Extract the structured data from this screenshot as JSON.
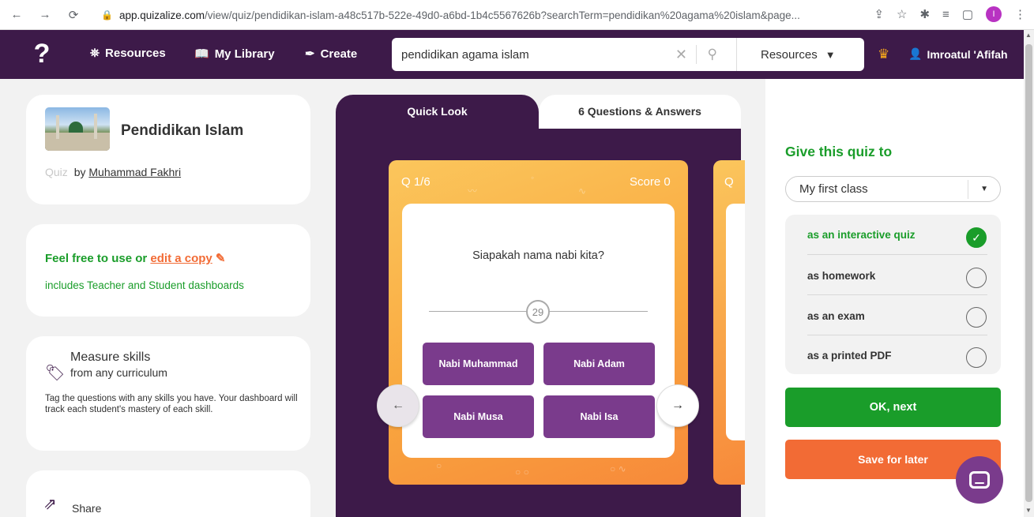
{
  "browser": {
    "nav": [
      "←",
      "→",
      "⟳"
    ],
    "url_host": "app.quizalize.com",
    "url_path": "/view/quiz/pendidikan-islam-a48c517b-522e-49d0-a6bd-1b4c5567626b?searchTerm=pendidikan%20agama%20islam&page...",
    "profile_initial": "I"
  },
  "header": {
    "logo": "?",
    "menu": [
      {
        "label": "Resources",
        "icon": "binoculars-icon"
      },
      {
        "label": "My Library",
        "icon": "book-icon"
      },
      {
        "label": "Create",
        "icon": "pen-icon"
      }
    ],
    "search_value": "pendidikan agama islam",
    "resources_dropdown": "Resources",
    "user_name": "Imroatul 'Afifah"
  },
  "quiz": {
    "title": "Pendidikan Islam",
    "type_label": "Quiz",
    "by": "by",
    "author": "Muhammad Fakhri"
  },
  "free": {
    "prefix": "Feel free to use or",
    "edit_link": "edit a copy",
    "sub": "includes Teacher and Student dashboards"
  },
  "skills": {
    "title": "Measure skills",
    "subtitle": "from any curriculum",
    "description": "Tag the questions with any skills you have. Your dashboard will track each student's mastery of each skill."
  },
  "share": {
    "label": "Share"
  },
  "tabs": {
    "quick_look": "Quick Look",
    "questions": "6 Questions & Answers"
  },
  "question_card": {
    "number": "Q 1/6",
    "score": "Score 0",
    "question": "Siapakah nama nabi kita?",
    "timer": "29",
    "answers": [
      "Nabi Muhammad",
      "Nabi Adam",
      "Nabi Musa",
      "Nabi Isa"
    ],
    "next_card_label": "Q"
  },
  "give": {
    "title": "Give this quiz to",
    "class_select": "My first class",
    "options": [
      {
        "label": "as an interactive quiz",
        "checked": true
      },
      {
        "label": "as homework",
        "checked": false
      },
      {
        "label": "as an exam",
        "checked": false
      },
      {
        "label": "as a printed PDF",
        "checked": false
      }
    ],
    "ok_button": "OK, next",
    "save_button": "Save for later"
  },
  "colors": {
    "brand_purple": "#3d1a49",
    "green": "#1a9d2a",
    "orange": "#f26b35",
    "answer_purple": "#7a3b8c"
  }
}
